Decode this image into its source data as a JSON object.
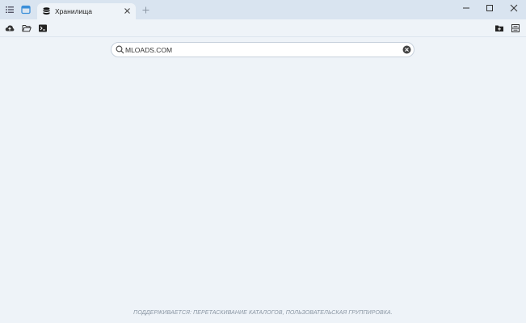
{
  "tab": {
    "title": "Хранилища"
  },
  "search": {
    "value": "MLOADS.COM",
    "placeholder": ""
  },
  "footer": {
    "hint": "ПОДДЕРЖИВАЕТСЯ: ПЕРЕТАСКИВАНИЕ КАТАЛОГОВ, ПОЛЬЗОВАТЕЛЬСКАЯ ГРУППИРОВКА."
  },
  "icons": {
    "menu": "list-icon",
    "window": "window-icon",
    "database": "database-icon",
    "cloud_upload": "cloud-upload-icon",
    "folder_open": "folder-open-icon",
    "terminal": "terminal-icon",
    "folder_new": "folder-add-icon",
    "layout": "split-layout-icon"
  },
  "colors": {
    "accent": "#3b8fd9",
    "titlebar": "#d9e4f0",
    "background": "#eef3f8"
  }
}
